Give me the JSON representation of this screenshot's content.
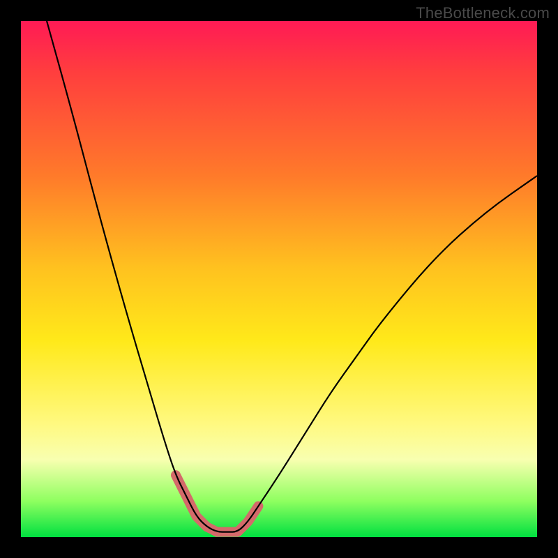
{
  "watermark": "TheBottleneck.com",
  "colors": {
    "highlight": "#d46a6a",
    "curve": "#000000"
  },
  "chart_data": {
    "type": "line",
    "title": "",
    "xlabel": "",
    "ylabel": "",
    "xlim": [
      0,
      100
    ],
    "ylim": [
      0,
      100
    ],
    "grid": false,
    "legend": false,
    "series": [
      {
        "name": "bottleneck-curve",
        "x": [
          5,
          10,
          15,
          20,
          25,
          28,
          30,
          32,
          34,
          36,
          38,
          40,
          42,
          44,
          46,
          50,
          55,
          60,
          65,
          70,
          80,
          90,
          100
        ],
        "y": [
          100,
          82,
          63,
          45,
          28,
          18,
          12,
          8,
          4,
          2,
          1,
          1,
          1,
          3,
          6,
          12,
          20,
          28,
          35,
          42,
          54,
          63,
          70
        ]
      }
    ],
    "highlighted_ranges": [
      {
        "name": "left-arm",
        "x_start": 30,
        "x_end": 36
      },
      {
        "name": "floor",
        "x_start": 36,
        "x_end": 42
      },
      {
        "name": "right-arm",
        "x_start": 42,
        "x_end": 47
      }
    ],
    "background_gradient": {
      "direction": "vertical",
      "stops": [
        {
          "pos": 0.0,
          "color": "#ff1a55"
        },
        {
          "pos": 0.3,
          "color": "#ff7a2a"
        },
        {
          "pos": 0.62,
          "color": "#ffe91a"
        },
        {
          "pos": 0.85,
          "color": "#f8ffb0"
        },
        {
          "pos": 1.0,
          "color": "#00e040"
        }
      ]
    }
  }
}
